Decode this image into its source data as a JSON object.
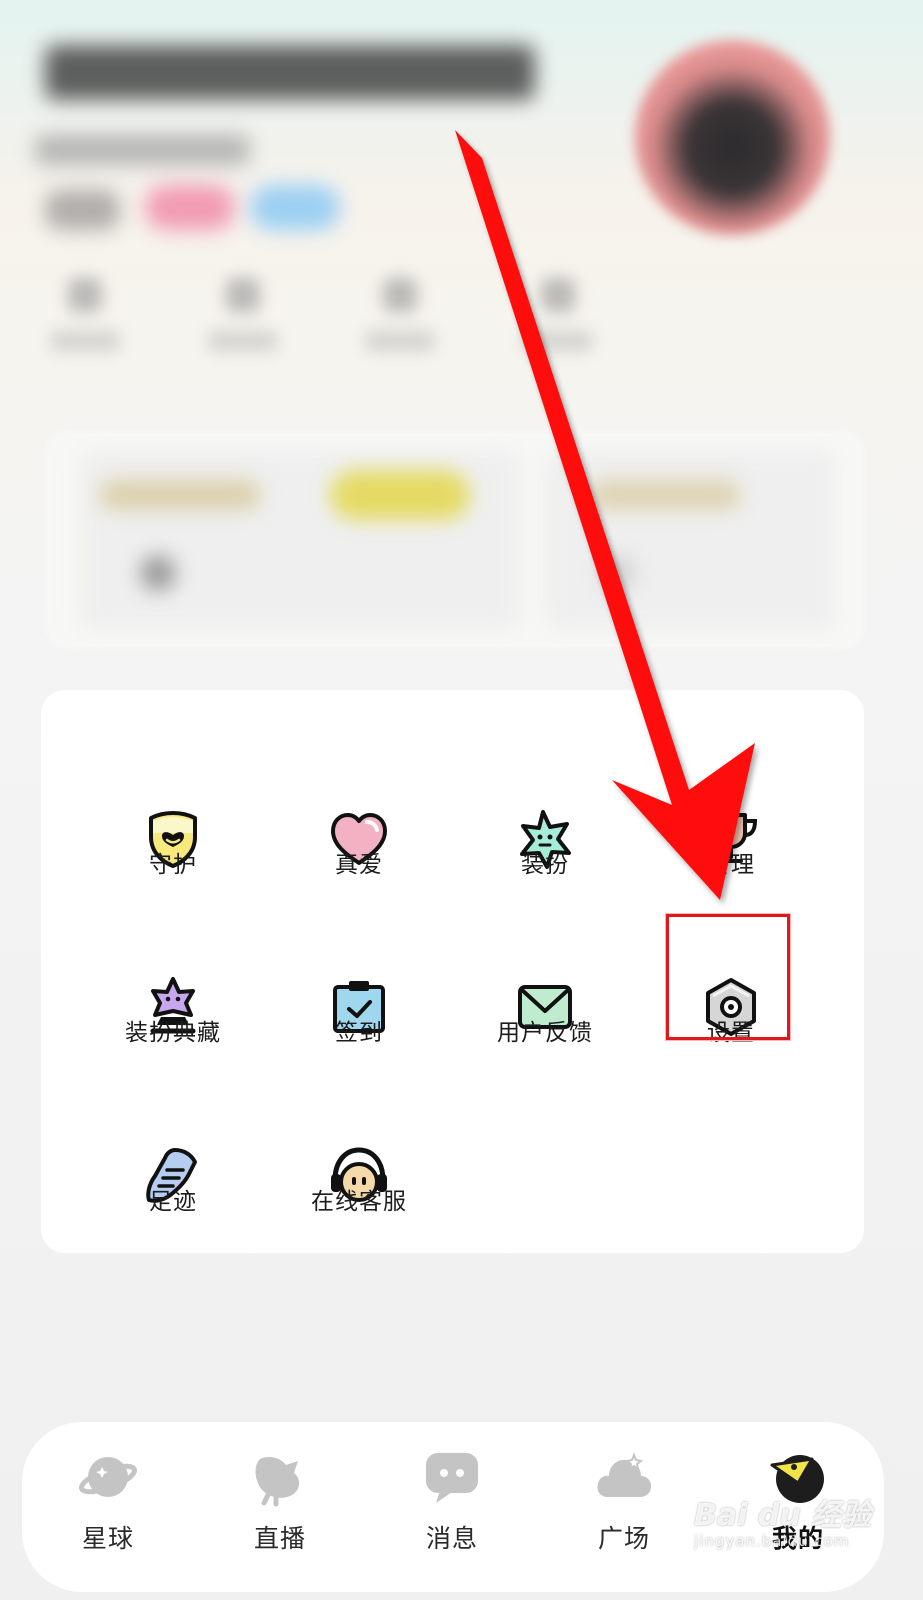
{
  "menu": {
    "items": [
      {
        "label": "守护",
        "icon": "shield-guard-icon"
      },
      {
        "label": "真爱",
        "icon": "heart-icon"
      },
      {
        "label": "装扮",
        "icon": "star-dress-up-icon"
      },
      {
        "label": "管理",
        "icon": "trophy-manage-icon"
      },
      {
        "label": "装扮典藏",
        "icon": "star-collection-icon"
      },
      {
        "label": "签到",
        "icon": "checkin-clipboard-icon"
      },
      {
        "label": "用户反馈",
        "icon": "envelope-feedback-icon"
      },
      {
        "label": "设置",
        "icon": "settings-hex-nut-icon"
      },
      {
        "label": "足迹",
        "icon": "footprint-note-icon"
      },
      {
        "label": "在线客服",
        "icon": "headset-support-icon"
      }
    ],
    "highlighted": "设置"
  },
  "tabbar": {
    "tabs": [
      {
        "label": "星球",
        "icon": "planet-icon",
        "active": false
      },
      {
        "label": "直播",
        "icon": "live-broadcast-icon",
        "active": false
      },
      {
        "label": "消息",
        "icon": "message-bubble-icon",
        "active": false
      },
      {
        "label": "广场",
        "icon": "square-cloud-icon",
        "active": false
      },
      {
        "label": "我的",
        "icon": "mine-avatar-icon",
        "active": true
      }
    ]
  },
  "watermark": {
    "main": "Bai du 经验",
    "sub": "jingyan.baidu.com"
  },
  "colors": {
    "annotation_red": "#e0171d",
    "arrow_red": "#ff0a0a",
    "card_bg": "#ffffff",
    "page_bg": "#f2f2f2"
  }
}
